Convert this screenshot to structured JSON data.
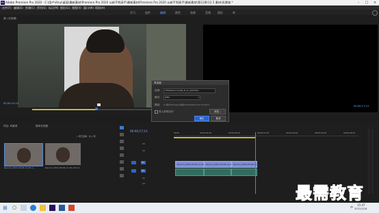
{
  "app": {
    "logo_text": "Pr",
    "title": "Adobe Premiere Pro 2020 - C:\\用户\\Ahui\\桌面\\最新素材\\Premiere Pro 2020 从新手到高手\\最新素材\\Premiere Pro 2020 从新手到高手\\最新素材\\第12章\\12.5 素材\\风景城 *"
  },
  "menu": [
    "文件(F)",
    "编辑(E)",
    "剪辑(C)",
    "序列(S)",
    "标记(M)",
    "图形(G)",
    "视图(V)",
    "窗口(W)",
    "帮助(H)"
  ],
  "workspaces": {
    "items": [
      "学习",
      "组件",
      "编辑",
      "颜色",
      "效果",
      "音频",
      "图形",
      "库"
    ],
    "active_index": 2
  },
  "source_monitor": {
    "tab": "源: (无剪辑)",
    "timecode": "00;00;14;14",
    "fit": "适合"
  },
  "program_monitor": {
    "timecode": "00;00;17;13",
    "fit": "适合"
  },
  "export_dialog": {
    "title": "导出帧",
    "name_label": "名称:",
    "name_value": "a5ba9ee4-ruanj8_af_ss_sss5dsss",
    "format_label": "格式:",
    "format_value": "JPEG",
    "path_label": "路径:",
    "path_value": "C:\\用户\\Pmagic\\文档\\Adobe\\Premiere Pro\\14.0",
    "browse": "浏览...",
    "import_checkbox": "导入到项目中",
    "ok": "确定",
    "cancel": "取消"
  },
  "project_panel": {
    "title": "项目: 风景城",
    "media_tab": "媒体浏览器",
    "item_count": "1 项已选择，共 2 项",
    "clips": [
      {
        "name": "Record_2022-03-06-11-49-1...",
        "duration": "15;11"
      },
      {
        "name": "Record_2022-03-06-11-49-1...",
        "duration": "15;11"
      }
    ]
  },
  "timeline": {
    "timecode": "00;00;17;13",
    "ruler": [
      "00;00",
      "00;00;04;29",
      "00;00;09;29",
      "00;00;14;29",
      "00;00;19;29",
      "00;00;24;29",
      "00;00;29;29"
    ],
    "tracks_video": [
      "V3",
      "V2",
      "V1"
    ],
    "tracks_audio": [
      "A1",
      "A2",
      "A3"
    ],
    "clips": [
      {
        "label": "Record_2022-03-06-11-49-1.mp4 [V]"
      },
      {
        "label": "Record_2022-03-06-11-49-1.mp4 [V]"
      },
      {
        "label": "Record_2022-03-06-11-49-1.mp4 [V]"
      }
    ]
  },
  "watermark": "最需教育",
  "taskbar": {
    "time": "15:47",
    "date": "2022/3/16",
    "lang": "中"
  },
  "colors": {
    "accent": "#2d64c8",
    "clip_video": "#7f8fd6",
    "clip_audio": "#2f6e5f",
    "watermark": "#1a2fb5"
  }
}
